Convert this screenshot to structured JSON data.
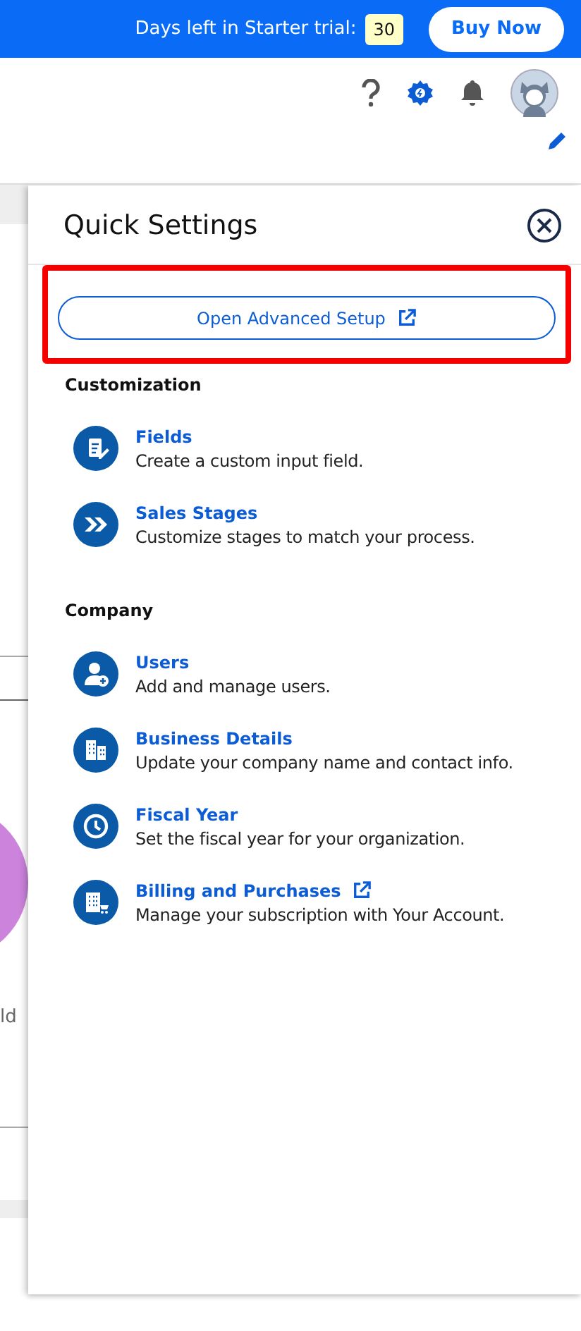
{
  "trial_bar": {
    "label": "Days left in Starter trial:",
    "days": "30",
    "buy_button": "Buy Now"
  },
  "background": {
    "partial_text": "ld"
  },
  "quick_settings": {
    "title": "Quick Settings",
    "advanced_button": {
      "label": "Open Advanced Setup",
      "external": true,
      "highlighted": true
    },
    "sections": [
      {
        "heading": "Customization",
        "items": [
          {
            "kind": "fields",
            "title": "Fields",
            "description": "Create a custom input field.",
            "external": false
          },
          {
            "kind": "stages",
            "title": "Sales Stages",
            "description": "Customize stages to match your process.",
            "external": false
          }
        ]
      },
      {
        "heading": "Company",
        "items": [
          {
            "kind": "users",
            "title": "Users",
            "description": "Add and manage users.",
            "external": false
          },
          {
            "kind": "building",
            "title": "Business Details",
            "description": "Update your company name and contact info.",
            "external": false
          },
          {
            "kind": "clock",
            "title": "Fiscal Year",
            "description": "Set the fiscal year for your organization.",
            "external": false
          },
          {
            "kind": "billing",
            "title": "Billing and Purchases",
            "description": "Manage your subscription with Your Account.",
            "external": true
          }
        ]
      }
    ]
  }
}
